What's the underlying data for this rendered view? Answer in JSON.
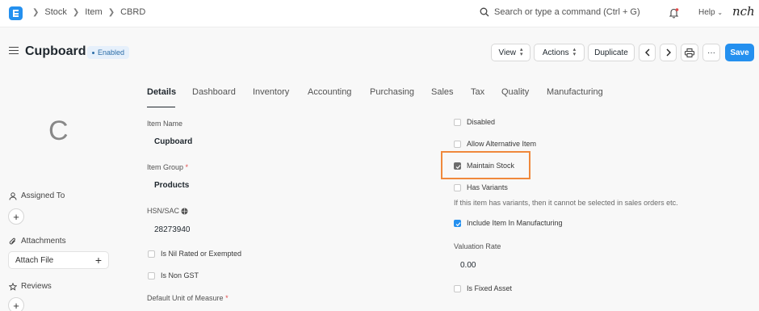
{
  "navbar": {
    "breadcrumbs": [
      "Stock",
      "Item",
      "CBRD"
    ],
    "search_placeholder": "Search or type a command (Ctrl + G)",
    "help_label": "Help",
    "user_signature": "nch"
  },
  "header": {
    "title": "Cupboard",
    "status": "Enabled",
    "view_label": "View",
    "actions_label": "Actions",
    "duplicate_label": "Duplicate",
    "more_label": "···",
    "save_label": "Save"
  },
  "sidebar": {
    "avatar_letter": "C",
    "assigned_to": "Assigned To",
    "attachments": "Attachments",
    "attach_file": "Attach File",
    "reviews": "Reviews"
  },
  "tabs": [
    "Details",
    "Dashboard",
    "Inventory",
    "Accounting",
    "Purchasing",
    "Sales",
    "Tax",
    "Quality",
    "Manufacturing"
  ],
  "left_fields": {
    "item_name_label": "Item Name",
    "item_name_value": "Cupboard",
    "item_group_label": "Item Group",
    "item_group_value": "Products",
    "hsn_label": "HSN/SAC",
    "hsn_value": "28273940",
    "nil_rated_label": "Is Nil Rated or Exempted",
    "non_gst_label": "Is Non GST",
    "uom_label": "Default Unit of Measure"
  },
  "right_fields": {
    "disabled_label": "Disabled",
    "allow_alt_label": "Allow Alternative Item",
    "maintain_stock_label": "Maintain Stock",
    "has_variants_label": "Has Variants",
    "variants_info": "If this item has variants, then it cannot be selected in sales orders etc.",
    "include_mfg_label": "Include Item In Manufacturing",
    "valuation_rate_label": "Valuation Rate",
    "valuation_rate_value": "0.00",
    "fixed_asset_label": "Is Fixed Asset"
  },
  "colors": {
    "primary": "#2490ef",
    "highlight": "#f0893c"
  }
}
